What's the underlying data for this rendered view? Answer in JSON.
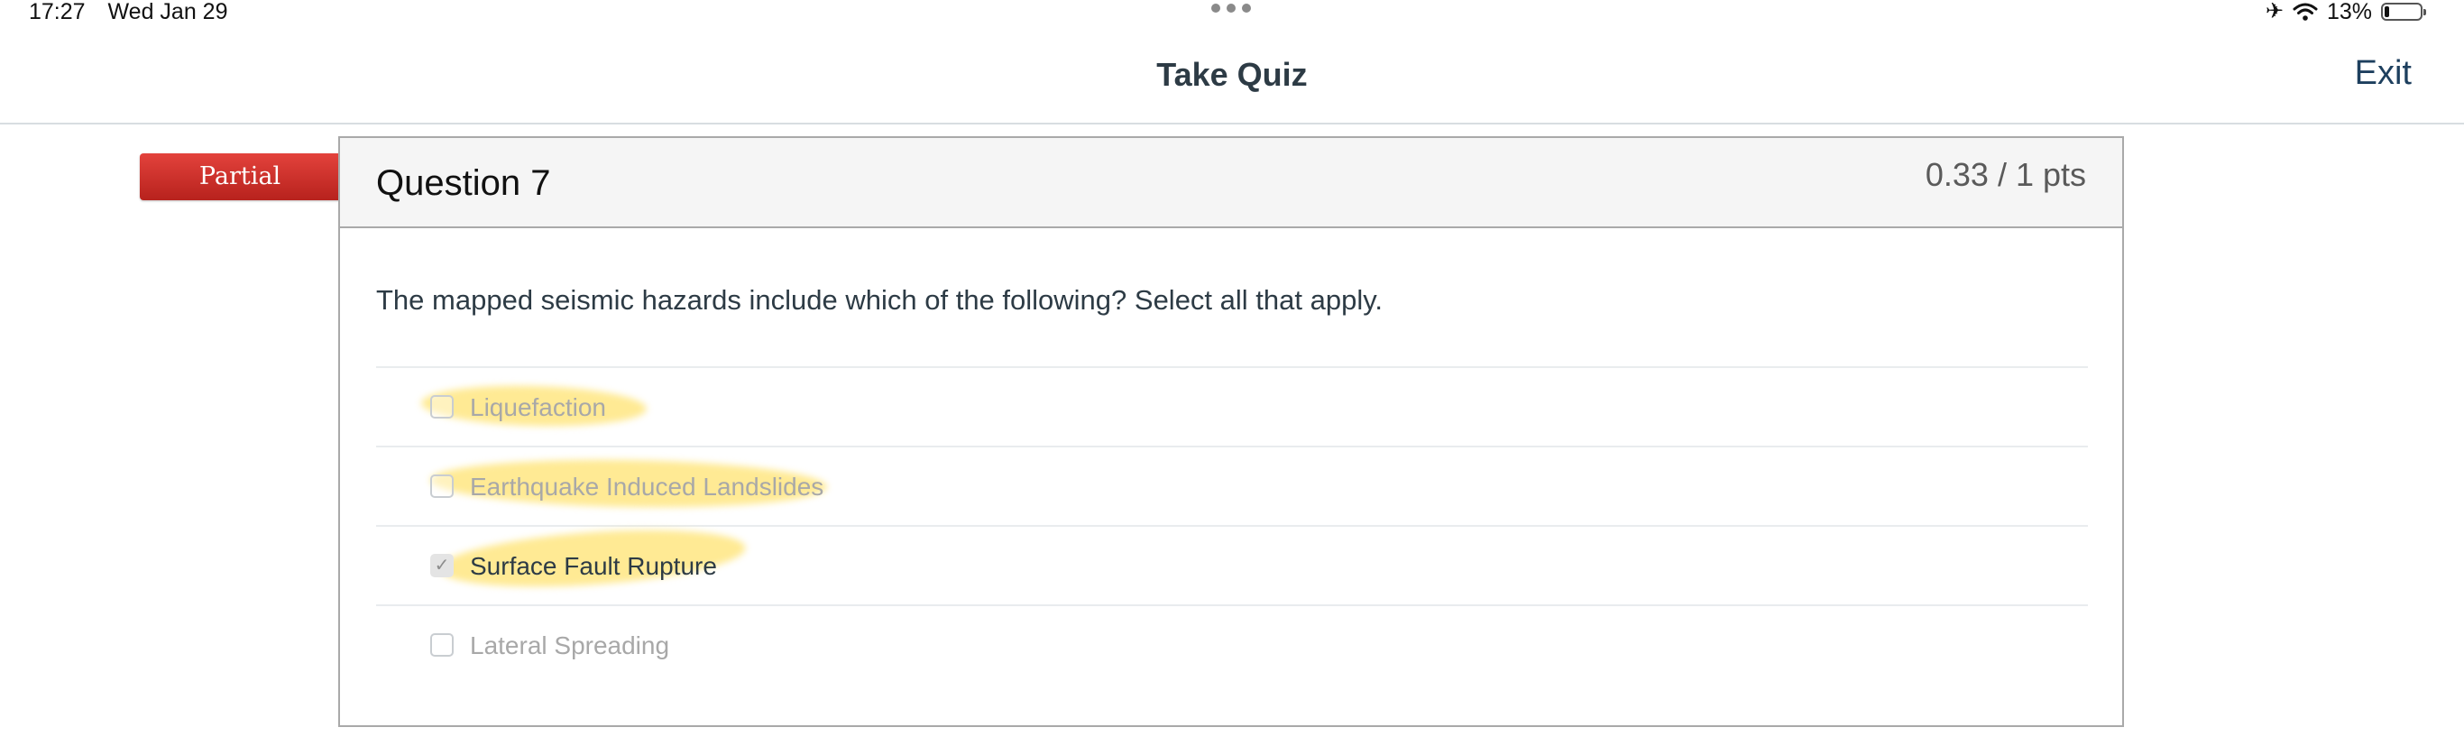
{
  "status_bar": {
    "time": "17:27",
    "date": "Wed Jan 29",
    "battery_percent": "13%",
    "battery_level": 0.13,
    "icons": [
      "airplane-icon",
      "wifi-icon",
      "battery-icon"
    ]
  },
  "header": {
    "title": "Take Quiz",
    "exit_label": "Exit"
  },
  "flag": {
    "label": "Partial",
    "color": "#cf302a"
  },
  "question": {
    "title": "Question 7",
    "points": "0.33 / 1 pts",
    "text": "The mapped seismic hazards include which of the following? Select all that apply.",
    "answers": [
      {
        "label": "Liquefaction",
        "checked": false,
        "highlighted": true
      },
      {
        "label": "Earthquake Induced Landslides",
        "checked": false,
        "highlighted": true
      },
      {
        "label": "Surface Fault Rupture",
        "checked": true,
        "highlighted": true
      },
      {
        "label": "Lateral Spreading",
        "checked": false,
        "highlighted": false
      }
    ]
  },
  "colors": {
    "highlight": "#ffda46",
    "text_primary": "#2d3b45",
    "exit_link": "#1d3f5e"
  }
}
